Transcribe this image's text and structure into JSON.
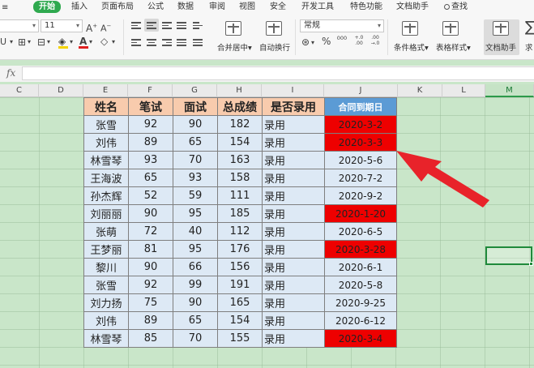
{
  "menu": {
    "items": [
      "开始",
      "插入",
      "页面布局",
      "公式",
      "数据",
      "审阅",
      "视图",
      "安全",
      "开发工具",
      "特色功能",
      "文档助手"
    ],
    "search": "查找"
  },
  "ribbon": {
    "font_size": "11",
    "number_format": "常规",
    "merge_center": "合并居中",
    "wrap_text": "自动换行",
    "conditional_format": "条件格式",
    "table_style": "表格样式",
    "doc_helper": "文档助手",
    "sum_partial": "求",
    "percent": "%",
    "thousands": "000",
    "inc_decimal": "+.0 .00",
    "dec_decimal": ".00 →.0",
    "sel_caret": "▾"
  },
  "formula_bar": {
    "fx_label": "fx",
    "value": ""
  },
  "columns": [
    "C",
    "D",
    "E",
    "F",
    "G",
    "H",
    "I",
    "J",
    "K",
    "L",
    "M"
  ],
  "table": {
    "headers": [
      "姓名",
      "笔试",
      "面试",
      "总成绩",
      "是否录用",
      "合同到期日"
    ],
    "rows": [
      {
        "name": "张雪",
        "written": "92",
        "interview": "90",
        "total": "182",
        "hired": "录用",
        "expiry": "2020-3-2",
        "expired": true
      },
      {
        "name": "刘伟",
        "written": "89",
        "interview": "65",
        "total": "154",
        "hired": "录用",
        "expiry": "2020-3-3",
        "expired": true
      },
      {
        "name": "林雪琴",
        "written": "93",
        "interview": "70",
        "total": "163",
        "hired": "录用",
        "expiry": "2020-5-6",
        "expired": false
      },
      {
        "name": "王海波",
        "written": "65",
        "interview": "93",
        "total": "158",
        "hired": "录用",
        "expiry": "2020-7-2",
        "expired": false
      },
      {
        "name": "孙杰辉",
        "written": "52",
        "interview": "59",
        "total": "111",
        "hired": "录用",
        "expiry": "2020-9-2",
        "expired": false
      },
      {
        "name": "刘丽丽",
        "written": "90",
        "interview": "95",
        "total": "185",
        "hired": "录用",
        "expiry": "2020-1-20",
        "expired": true
      },
      {
        "name": "张萌",
        "written": "72",
        "interview": "40",
        "total": "112",
        "hired": "录用",
        "expiry": "2020-6-5",
        "expired": false
      },
      {
        "name": "王梦丽",
        "written": "81",
        "interview": "95",
        "total": "176",
        "hired": "录用",
        "expiry": "2020-3-28",
        "expired": true
      },
      {
        "name": "黎川",
        "written": "90",
        "interview": "66",
        "total": "156",
        "hired": "录用",
        "expiry": "2020-6-1",
        "expired": false
      },
      {
        "name": "张雪",
        "written": "92",
        "interview": "99",
        "total": "191",
        "hired": "录用",
        "expiry": "2020-5-8",
        "expired": false
      },
      {
        "name": "刘力扬",
        "written": "75",
        "interview": "90",
        "total": "165",
        "hired": "录用",
        "expiry": "2020-9-25",
        "expired": false
      },
      {
        "name": "刘伟",
        "written": "89",
        "interview": "65",
        "total": "154",
        "hired": "录用",
        "expiry": "2020-6-12",
        "expired": false
      },
      {
        "name": "林雪琴",
        "written": "85",
        "interview": "70",
        "total": "155",
        "hired": "录用",
        "expiry": "2020-3-4",
        "expired": true
      }
    ]
  },
  "colors": {
    "header_bg": "#f8cbad",
    "date_header_bg": "#5b9bd5",
    "cell_bg": "#dde9f5",
    "expired_bg": "#ee0000",
    "sheet_bg": "#c9e6c9",
    "accent": "#2fa94f",
    "arrow": "#e8232a"
  },
  "icons": {
    "alignment": "align-icon",
    "fill": "fill-color-icon",
    "font_color": "font-color-icon",
    "eraser": "clear-format-icon",
    "arrow": "annotation-arrow"
  }
}
